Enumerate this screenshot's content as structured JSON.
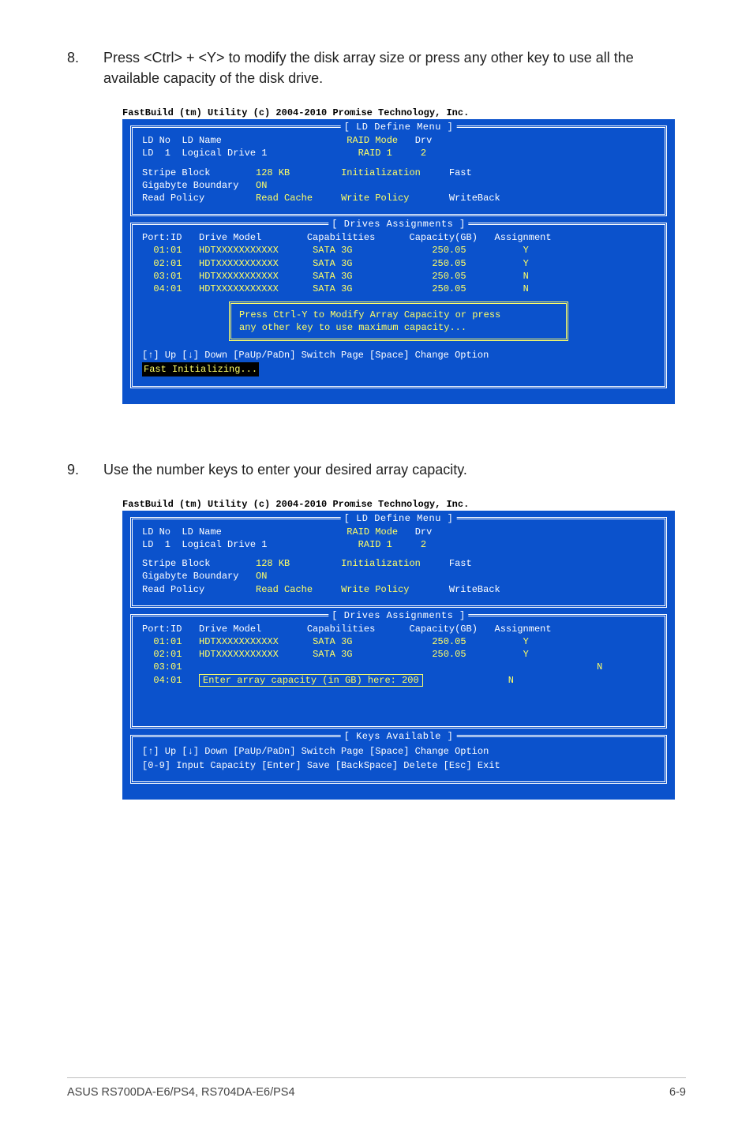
{
  "step8": {
    "num": "8.",
    "text": "Press <Ctrl> + <Y> to modify the disk array size or press any other key to use all the available capacity of the disk drive."
  },
  "step9": {
    "num": "9.",
    "text": "Use the number keys to enter your desired array capacity."
  },
  "caption": "FastBuild (tm) Utility (c) 2004-2010 Promise Technology, Inc.",
  "titles": {
    "define": "LD Define Menu",
    "drives": "Drives Assignments",
    "keys": "Keys Available"
  },
  "define": {
    "hdr": {
      "ldno": "LD No",
      "ldname": "LD Name",
      "raidmode": "RAID Mode",
      "drv": "Drv"
    },
    "r1": {
      "ldno": "LD  1",
      "ldname": "Logical Drive 1",
      "raidmode": "RAID 1",
      "drv": "2"
    },
    "sb": {
      "l": "Stripe Block",
      "v": "128 KB",
      "l2": "Initialization",
      "v2": "Fast"
    },
    "gb": {
      "l": "Gigabyte Boundary",
      "v": "ON"
    },
    "rp": {
      "l": "Read Policy",
      "v": "Read Cache",
      "l2": "Write Policy",
      "v2": "WriteBack"
    }
  },
  "drives_hdr": {
    "port": "Port:ID",
    "model": "Drive Model",
    "caps": "Capabilities",
    "cap": "Capacity(GB)",
    "asg": "Assignment"
  },
  "drives8": [
    {
      "port": "01:01",
      "model": "HDTXXXXXXXXXXX",
      "caps": "SATA 3G",
      "cap": "250.05",
      "asg": "Y"
    },
    {
      "port": "02:01",
      "model": "HDTXXXXXXXXXXX",
      "caps": "SATA 3G",
      "cap": "250.05",
      "asg": "Y"
    },
    {
      "port": "03:01",
      "model": "HDTXXXXXXXXXXX",
      "caps": "SATA 3G",
      "cap": "250.05",
      "asg": "N"
    },
    {
      "port": "04:01",
      "model": "HDTXXXXXXXXXXX",
      "caps": "SATA 3G",
      "cap": "250.05",
      "asg": "N"
    }
  ],
  "drives9": [
    {
      "port": "01:01",
      "model": "HDTXXXXXXXXXXX",
      "caps": "SATA 3G",
      "cap": "250.05",
      "asg": "Y"
    },
    {
      "port": "02:01",
      "model": "HDTXXXXXXXXXXX",
      "caps": "SATA 3G",
      "cap": "250.05",
      "asg": "Y"
    },
    {
      "port": "03:01",
      "model": "",
      "caps": "",
      "cap": "",
      "asg": "N"
    },
    {
      "port": "04:01",
      "model": "",
      "caps": "",
      "cap": "",
      "asg": "N"
    }
  ],
  "modal": {
    "l1": "Press Ctrl-Y to Modify Array Capacity or press",
    "l2": "any other key to use maximum capacity..."
  },
  "prompt9": "Enter array capacity (in GB) here: 200",
  "keys8": {
    "line": "[↑] Up [↓] Down [PaUp/PaDn] Switch Page [Space] Change Option",
    "status": "Fast Initializing..."
  },
  "keys9": {
    "line1": "[↑] Up [↓] Down [PaUp/PaDn] Switch Page [Space] Change Option",
    "line2": "[0-9] Input Capacity [Enter] Save [BackSpace] Delete [Esc] Exit"
  },
  "footer": {
    "left": "ASUS RS700DA-E6/PS4, RS704DA-E6/PS4",
    "right": "6-9"
  }
}
